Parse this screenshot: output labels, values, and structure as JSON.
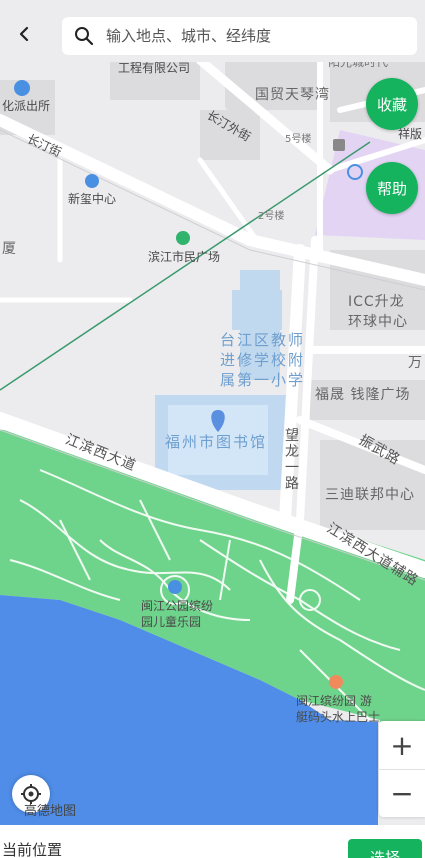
{
  "search": {
    "placeholder": "输入地点、城市、经纬度"
  },
  "actions": {
    "favorite": "收藏",
    "help": "帮助",
    "select": "选择"
  },
  "zoom": {
    "in": "+",
    "out": "−"
  },
  "attribution": "高德地图",
  "bottom": {
    "current_location": "当前位置"
  },
  "map_labels": {
    "gongcheng": "工程有限公司",
    "yangguang": "阳光城时代",
    "guomao": "国贸天琴湾",
    "paichusuo": "化派出所",
    "changting_wai": "长汀外街",
    "building5": "5号楼",
    "xiangban": "祥版",
    "changting": "长汀街",
    "xinying": "新玺中心",
    "building2": "2号楼",
    "xia": "厦",
    "binjiang_square": "滨江市民广场",
    "icc": "ICC升龙\n环球中心",
    "school": "台江区教师\n进修学校附\n属第一小学",
    "wan": "万",
    "fusheng": "福晟 钱隆广场",
    "library": "福州市图书馆",
    "jiangbin_west": "江滨西大道",
    "zhenwu": "振武路",
    "wanglong": "望\n龙\n一\n路",
    "sandi": "三迪联邦中心",
    "jiangbin_aux": "江滨西大道辅路",
    "park_kids": "闽江公园缤纷\n园儿童乐园",
    "pier": "闽江缤纷园 游\n艇码头水上巴士"
  },
  "colors": {
    "accent": "#16b35f",
    "water": "#4f8de8",
    "park": "#6fd48b",
    "road": "#ffffff",
    "land": "#ececee",
    "building": "#dcdcde",
    "marker": "#5b8fe0"
  },
  "icons": {
    "back": "chevron-left-icon",
    "search": "search-icon",
    "locate": "locate-icon",
    "marker": "map-pin-icon"
  }
}
